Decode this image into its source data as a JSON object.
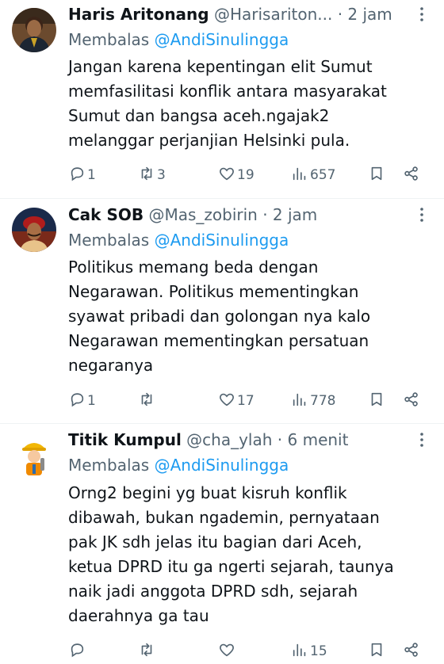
{
  "replies": [
    {
      "name": "Haris Aritonang",
      "handle": "@Harisariton...",
      "time": "· 2 jam",
      "replying_prefix": "Membalas ",
      "replying_to": "@AndiSinulingga",
      "text": "Jangan karena kepentingan elit Sumut\nmemfasilitasi konflik antara masyarakat\nSumut dan bangsa aceh.ngajak2\nmelanggar perjanjian Helsinki pula.",
      "replies_count": "1",
      "retweets_count": "3",
      "likes_count": "19",
      "views_count": "657"
    },
    {
      "name": "Cak SOB",
      "handle": "@Mas_zobirin",
      "time": "· 2 jam",
      "replying_prefix": "Membalas ",
      "replying_to": "@AndiSinulingga",
      "text": "Politikus memang beda dengan\nNegarawan. Politikus mementingkan\nsyawat pribadi dan golongan nya kalo\nNegarawan mementingkan persatuan\nnegaranya",
      "replies_count": "1",
      "retweets_count": "",
      "likes_count": "17",
      "views_count": "778"
    },
    {
      "name": "Titik Kumpul",
      "handle": "@cha_ylah",
      "time": "· 6 menit",
      "replying_prefix": "Membalas ",
      "replying_to": "@AndiSinulingga",
      "text": "Orng2 begini yg buat kisruh konflik\ndibawah, bukan ngademin, pernyataan\npak JK sdh jelas itu bagian dari Aceh,\nketua DPRD itu ga ngerti sejarah, taunya\nnaik jadi anggota DPRD sdh, sejarah\ndaerahnya ga tau",
      "replies_count": "",
      "retweets_count": "",
      "likes_count": "",
      "views_count": "15"
    }
  ],
  "icons": {
    "reply": "reply-icon",
    "retweet": "retweet-icon",
    "like": "heart-icon",
    "views": "views-icon",
    "bookmark": "bookmark-icon",
    "share": "share-icon",
    "more": "more-icon"
  },
  "colors": {
    "text": "#0f1419",
    "secondary": "#536471",
    "link": "#1d9bf0",
    "divider": "#eff3f4"
  }
}
